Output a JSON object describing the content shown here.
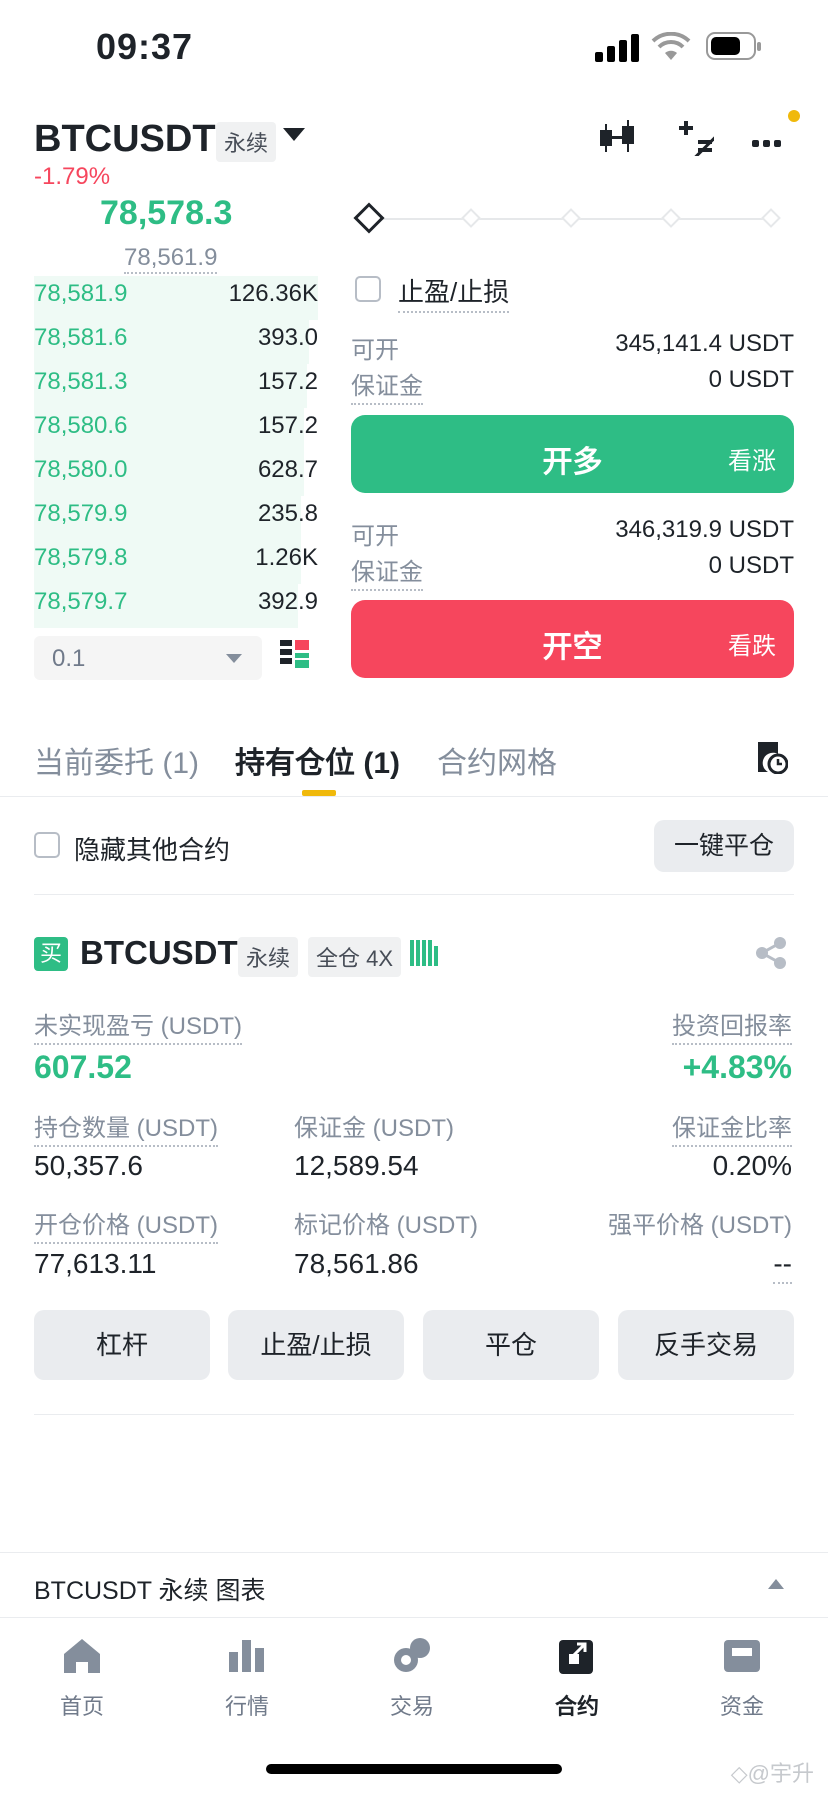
{
  "status_bar": {
    "time": "09:37"
  },
  "header": {
    "symbol": "BTCUSDT",
    "contract_type": "永续",
    "change": "-1.79%",
    "icons": [
      "candlestick-icon",
      "calculator-icon",
      "more-icon"
    ]
  },
  "orderbook": {
    "last_price": "78,578.3",
    "mark_price": "78,561.9",
    "rows": [
      {
        "price": "78,581.9",
        "qty": "126.36K",
        "depth": 1.0
      },
      {
        "price": "78,581.6",
        "qty": "393.0",
        "depth": 0.97
      },
      {
        "price": "78,581.3",
        "qty": "157.2",
        "depth": 0.96
      },
      {
        "price": "78,580.6",
        "qty": "157.2",
        "depth": 0.95
      },
      {
        "price": "78,580.0",
        "qty": "628.7",
        "depth": 0.95
      },
      {
        "price": "78,579.9",
        "qty": "235.8",
        "depth": 0.94
      },
      {
        "price": "78,579.8",
        "qty": "1.26K",
        "depth": 0.94
      },
      {
        "price": "78,579.7",
        "qty": "392.9",
        "depth": 0.93
      }
    ],
    "depth_step": "0.1"
  },
  "order_form": {
    "tpsl_label": "止盈/止损",
    "long": {
      "avail_label": "可开",
      "avail_value": "345,141.4 USDT",
      "margin_label": "保证金",
      "margin_value": "0 USDT",
      "button": "开多",
      "button_side": "看涨"
    },
    "short": {
      "avail_label": "可开",
      "avail_value": "346,319.9 USDT",
      "margin_label": "保证金",
      "margin_value": "0 USDT",
      "button": "开空",
      "button_side": "看跌"
    }
  },
  "tabs": [
    "当前委托 (1)",
    "持有仓位 (1)",
    "合约网格"
  ],
  "filter": {
    "hide_label": "隐藏其他合约",
    "close_all": "一键平仓"
  },
  "position": {
    "side": "买",
    "symbol": "BTCUSDT",
    "contract_type": "永续",
    "margin_mode": "全仓 4X",
    "upnl_label": "未实现盈亏 (USDT)",
    "upnl_value": "607.52",
    "roe_label": "投资回报率",
    "roe_value": "+4.83%",
    "size_label": "持仓数量 (USDT)",
    "size_value": "50,357.6",
    "margin_label": "保证金 (USDT)",
    "margin_value": "12,589.54",
    "margin_ratio_label": "保证金比率",
    "margin_ratio_value": "0.20%",
    "entry_label": "开仓价格 (USDT)",
    "entry_value": "77,613.11",
    "markp_label": "标记价格 (USDT)",
    "markp_value": "78,561.86",
    "liq_label": "强平价格 (USDT)",
    "liq_value": "--",
    "buttons": [
      "杠杆",
      "止盈/止损",
      "平仓",
      "反手交易"
    ]
  },
  "chart_bar": {
    "label": "BTCUSDT 永续  图表"
  },
  "nav": [
    {
      "label": "首页",
      "icon": "home-icon"
    },
    {
      "label": "行情",
      "icon": "markets-icon"
    },
    {
      "label": "交易",
      "icon": "trade-icon"
    },
    {
      "label": "合约",
      "icon": "futures-icon",
      "active": true
    },
    {
      "label": "资金",
      "icon": "wallet-icon"
    }
  ],
  "watermark": "◇@宇升",
  "colors": {
    "green": "#2ebd85",
    "red": "#f6465d",
    "accent": "#f0b90b"
  }
}
